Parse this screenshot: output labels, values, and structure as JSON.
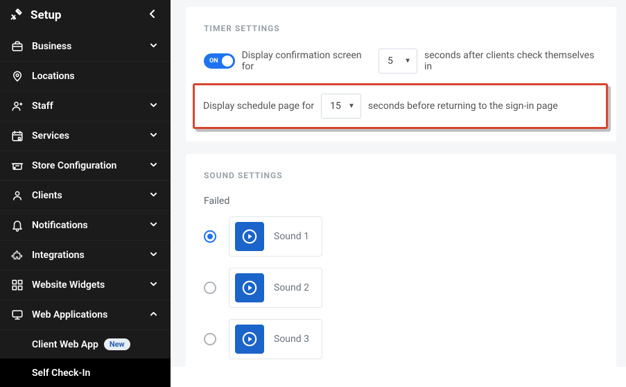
{
  "sidebar": {
    "title": "Setup",
    "items": [
      {
        "label": "Business",
        "icon": "briefcase",
        "expandable": true,
        "expanded": false
      },
      {
        "label": "Locations",
        "icon": "pin",
        "expandable": false
      },
      {
        "label": "Staff",
        "icon": "person",
        "expandable": true,
        "expanded": false
      },
      {
        "label": "Services",
        "icon": "calendar",
        "expandable": true,
        "expanded": false
      },
      {
        "label": "Store Configuration",
        "icon": "store",
        "expandable": true,
        "expanded": false
      },
      {
        "label": "Clients",
        "icon": "client",
        "expandable": true,
        "expanded": false
      },
      {
        "label": "Notifications",
        "icon": "bell",
        "expandable": true,
        "expanded": false
      },
      {
        "label": "Integrations",
        "icon": "puzzle",
        "expandable": true,
        "expanded": false
      },
      {
        "label": "Website Widgets",
        "icon": "widgets",
        "expandable": true,
        "expanded": false
      },
      {
        "label": "Web Applications",
        "icon": "monitor",
        "expandable": true,
        "expanded": true
      }
    ],
    "subitems": [
      {
        "label": "Client Web App",
        "badge": "New",
        "active": false
      },
      {
        "label": "Self Check-In",
        "active": true
      }
    ]
  },
  "timer": {
    "heading": "TIMER SETTINGS",
    "toggle_label": "ON",
    "confirm_prefix": "Display confirmation screen for",
    "confirm_value": "5",
    "confirm_suffix": "seconds after clients check themselves in",
    "schedule_prefix": "Display schedule page for",
    "schedule_value": "15",
    "schedule_suffix": "seconds before returning to the sign-in page"
  },
  "sound": {
    "heading": "SOUND SETTINGS",
    "sublabel": "Failed",
    "items": [
      {
        "name": "Sound 1",
        "selected": true
      },
      {
        "name": "Sound 2",
        "selected": false
      },
      {
        "name": "Sound 3",
        "selected": false
      }
    ]
  }
}
